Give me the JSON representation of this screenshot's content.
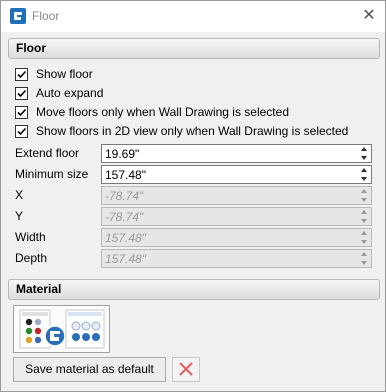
{
  "window": {
    "title": "Floor",
    "close_glyph": "✕"
  },
  "floor_section": {
    "header": "Floor",
    "checkboxes": [
      {
        "label": "Show floor",
        "checked": true
      },
      {
        "label": "Auto expand",
        "checked": true
      },
      {
        "label": "Move floors only when Wall Drawing is selected",
        "checked": true
      },
      {
        "label": "Show floors in 2D view only when Wall Drawing is selected",
        "checked": true
      }
    ],
    "fields": [
      {
        "label": "Extend floor",
        "value": "19.69\"",
        "enabled": true
      },
      {
        "label": "Minimum size",
        "value": "157.48\"",
        "enabled": true
      },
      {
        "label": "X",
        "value": "-78.74\"",
        "enabled": false
      },
      {
        "label": "Y",
        "value": "-78.74\"",
        "enabled": false
      },
      {
        "label": "Width",
        "value": "157.48\"",
        "enabled": false
      },
      {
        "label": "Depth",
        "value": "157.48\"",
        "enabled": false
      }
    ]
  },
  "material_section": {
    "header": "Material",
    "thumbnail_icon": "material-preview-icon",
    "save_button": "Save material as default",
    "clear_icon": "red-x-icon"
  },
  "colors": {
    "accent": "#1e6fb8",
    "clear_red": "#e06060"
  }
}
